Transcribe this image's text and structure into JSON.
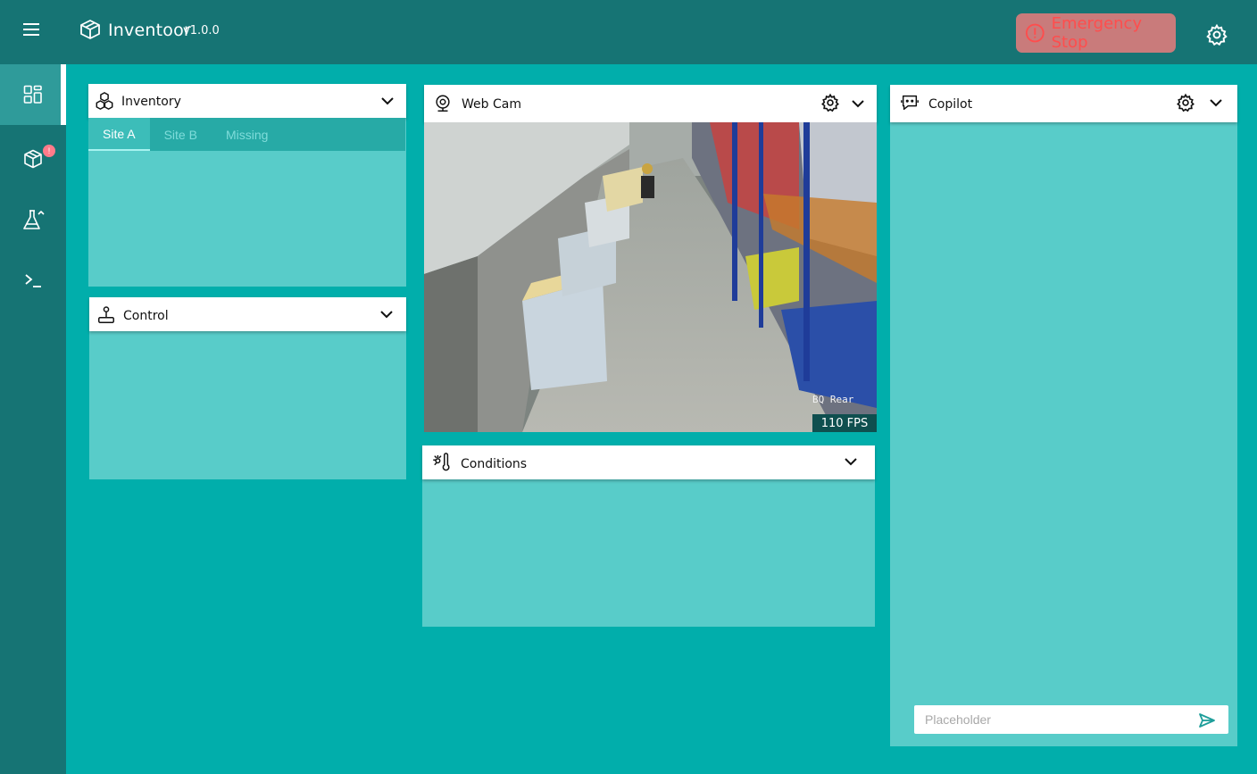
{
  "app": {
    "name": "Inventoor",
    "version": "v1.0.0"
  },
  "header": {
    "emergency_label": "Emergency Stop"
  },
  "sidebar": {
    "items": [
      {
        "icon": "dashboard-icon",
        "active": true
      },
      {
        "icon": "package-icon",
        "badge": "!"
      },
      {
        "icon": "flask-icon"
      },
      {
        "icon": "terminal-icon"
      }
    ]
  },
  "panels": {
    "inventory": {
      "title": "Inventory",
      "tabs": [
        "Site A",
        "Site B",
        "Missing"
      ],
      "active_tab": "Site A"
    },
    "control": {
      "title": "Control"
    },
    "webcam": {
      "title": "Web Cam",
      "fps": "110 FPS",
      "overlay_text": "BQ Rear"
    },
    "conditions": {
      "title": "Conditions"
    },
    "copilot": {
      "title": "Copilot",
      "input_placeholder": "Placeholder"
    }
  },
  "colors": {
    "accent": "#01aeab",
    "bar": "#167474",
    "panel_body": "#58ccc9",
    "danger": "#ff4d4d"
  }
}
